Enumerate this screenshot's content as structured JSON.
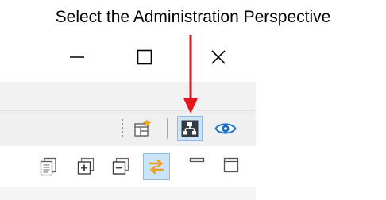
{
  "caption": "Select the Administration Perspective",
  "colors": {
    "arrow": "#e8141b",
    "selected_background": "#cce4f7",
    "selected_border": "#8fbbe3",
    "eye": "#1a73c8",
    "sync_orange": "#f0a020"
  },
  "window_controls": [
    {
      "icon": "minimize-icon"
    },
    {
      "icon": "maximize-icon"
    },
    {
      "icon": "close-icon"
    }
  ],
  "perspective_toolbar": {
    "items": [
      {
        "icon": "open-perspective-icon"
      },
      {
        "icon": "administration-perspective-icon",
        "selected": true
      },
      {
        "icon": "eye-icon"
      }
    ]
  },
  "view_toolbar": {
    "items": [
      {
        "icon": "copy-icon"
      },
      {
        "icon": "expand-all-icon"
      },
      {
        "icon": "collapse-all-icon"
      },
      {
        "icon": "link-with-editor-icon",
        "selected": true
      },
      {
        "icon": "minimize-view-icon"
      },
      {
        "icon": "maximize-view-icon"
      }
    ]
  }
}
